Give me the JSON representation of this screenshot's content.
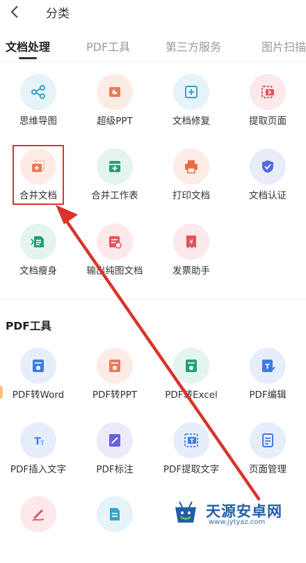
{
  "header": {
    "title": "分类"
  },
  "tabs": [
    {
      "label": "文档处理",
      "active": true
    },
    {
      "label": "PDF工具",
      "active": false
    },
    {
      "label": "第三方服务",
      "active": false
    },
    {
      "label": "图片扫描",
      "active": false
    }
  ],
  "doc_tools": [
    {
      "label": "思维导图",
      "icon": "mind-map-icon",
      "bg": "#e6f4fa",
      "color": "#3aa0c8"
    },
    {
      "label": "超级PPT",
      "icon": "ppt-icon",
      "bg": "#fdece6",
      "color": "#ec7a55"
    },
    {
      "label": "文档修复",
      "icon": "doc-repair-icon",
      "bg": "#e6f4fa",
      "color": "#3aa0c8"
    },
    {
      "label": "提取页面",
      "icon": "extract-page-icon",
      "bg": "#fde8ea",
      "color": "#e2525e"
    },
    {
      "label": "合并文档",
      "icon": "merge-doc-icon",
      "bg": "#fdece6",
      "color": "#ec7a55"
    },
    {
      "label": "合并工作表",
      "icon": "merge-sheet-icon",
      "bg": "#e4f5ee",
      "color": "#20a272"
    },
    {
      "label": "打印文档",
      "icon": "print-icon",
      "bg": "#fdece6",
      "color": "#ec6a45"
    },
    {
      "label": "文档认证",
      "icon": "verify-icon",
      "bg": "#e9edfb",
      "color": "#4e6ae0"
    },
    {
      "label": "文档瘦身",
      "icon": "slim-doc-icon",
      "bg": "#e4f5ee",
      "color": "#20a272"
    },
    {
      "label": "输出纯图文档",
      "icon": "image-doc-icon",
      "bg": "#fde8ea",
      "color": "#e2525e"
    },
    {
      "label": "发票助手",
      "icon": "invoice-icon",
      "bg": "#fde8ea",
      "color": "#e2525e"
    }
  ],
  "pdf_section": {
    "title": "PDF工具"
  },
  "pdf_tools": [
    {
      "label": "PDF转Word",
      "icon": "pdf-to-word-icon",
      "bg": "#e7eefb",
      "color": "#3d7ce6"
    },
    {
      "label": "PDF转PPT",
      "icon": "pdf-to-ppt-icon",
      "bg": "#fdece6",
      "color": "#ec7a55"
    },
    {
      "label": "PDF转Excel",
      "icon": "pdf-to-excel-icon",
      "bg": "#e4f5ee",
      "color": "#20a272"
    },
    {
      "label": "PDF编辑",
      "icon": "pdf-edit-icon",
      "bg": "#e7eefb",
      "color": "#3d7ce6"
    },
    {
      "label": "PDF插入文字",
      "icon": "pdf-insert-text-icon",
      "bg": "#e7eefb",
      "color": "#3d7ce6"
    },
    {
      "label": "PDF标注",
      "icon": "pdf-annotate-icon",
      "bg": "#eceafb",
      "color": "#6b5fe0"
    },
    {
      "label": "PDF提取文字",
      "icon": "pdf-extract-text-icon",
      "bg": "#e7eefb",
      "color": "#3d7ce6"
    },
    {
      "label": "页面管理",
      "icon": "page-manage-icon",
      "bg": "#e7eefb",
      "color": "#3d7ce6"
    },
    {
      "label": "",
      "icon": "pdf-sign-icon",
      "bg": "#fde8ea",
      "color": "#e2525e"
    },
    {
      "label": "",
      "icon": "pdf-doc-icon",
      "bg": "#e6f4fa",
      "color": "#3aa0c8"
    }
  ],
  "watermark": {
    "name": "天源安卓网",
    "url": "www.jytyaz.com"
  },
  "annotation": {
    "color": "#d9342b"
  }
}
